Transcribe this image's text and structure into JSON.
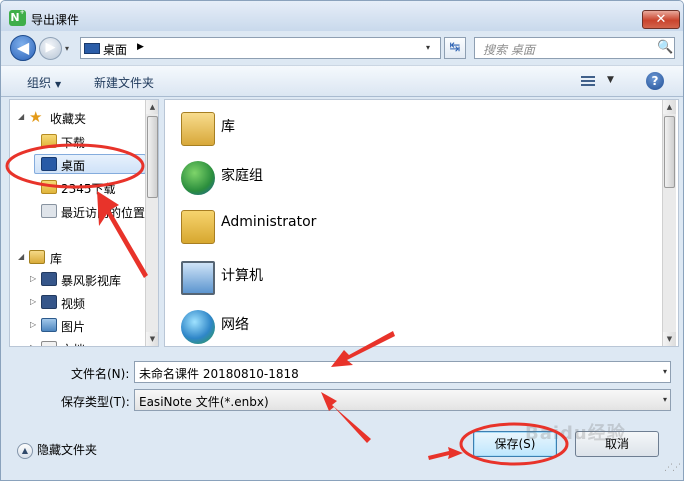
{
  "window": {
    "title": "导出课件",
    "app_icon": "easinote-icon",
    "close_label": "✕"
  },
  "navbar": {
    "back_label": "◀",
    "forward_label": "▶",
    "history_caret": "▾",
    "breadcrumb": "桌面",
    "crumb_chevron": "▶",
    "address_caret": "▾",
    "refresh_label": "↹",
    "search_placeholder": "搜索 桌面",
    "search_icon": "🔍"
  },
  "toolbar": {
    "organize": "组织",
    "new_folder": "新建文件夹",
    "organize_caret": "▼",
    "view_caret": "▼",
    "help_label": "?"
  },
  "nav_pane": {
    "items": [
      {
        "label": "收藏夹",
        "icon": "star-icon",
        "tri": "◢"
      },
      {
        "label": "下载",
        "icon": "download-folder-icon"
      },
      {
        "label": "桌面",
        "icon": "desktop-icon",
        "selected": true
      },
      {
        "label": "2345下载",
        "icon": "folder-icon"
      },
      {
        "label": "最近访问的位置",
        "icon": "recent-places-icon"
      },
      {
        "label": "库",
        "icon": "library-icon",
        "tri": "◢"
      },
      {
        "label": "暴风影视库",
        "icon": "video-library-icon",
        "tri": "▷"
      },
      {
        "label": "视频",
        "icon": "videos-icon",
        "tri": "▷"
      },
      {
        "label": "图片",
        "icon": "pictures-icon",
        "tri": "▷"
      },
      {
        "label": "文档",
        "icon": "documents-icon",
        "tri": "▷"
      }
    ]
  },
  "main_pane": {
    "items": [
      {
        "name": "库",
        "icon": "libraries-icon"
      },
      {
        "name": "家庭组",
        "icon": "homegroup-icon"
      },
      {
        "name": "Administrator",
        "icon": "user-folder-icon"
      },
      {
        "name": "计算机",
        "icon": "computer-icon"
      },
      {
        "name": "网络",
        "icon": "network-icon"
      }
    ]
  },
  "form": {
    "filename_label": "文件名(N):",
    "filename_value": "未命名课件 20180810-1818",
    "filetype_label": "保存类型(T):",
    "filetype_value": "EasiNote 文件(*.enbx)",
    "caret": "▾"
  },
  "footer": {
    "hide_folders": "隐藏文件夹",
    "hide_icon": "▲",
    "save": "保存(S)",
    "cancel": "取消",
    "watermark": "Baidu经验"
  },
  "scroll": {
    "up": "▲",
    "down": "▼"
  },
  "colors": {
    "annotation": "#e8332a",
    "selection": "#cfe2f8"
  }
}
